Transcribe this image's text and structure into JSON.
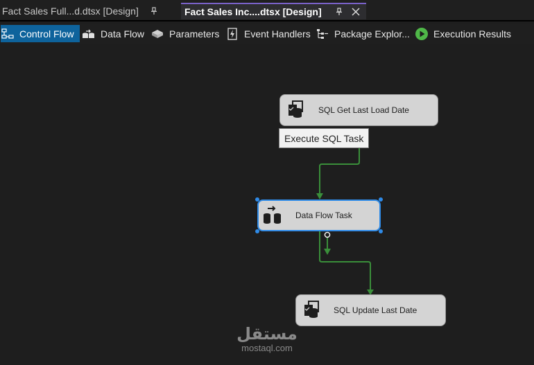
{
  "tabs": [
    {
      "title": "Fact Sales Full...d.dtsx [Design]",
      "active": false
    },
    {
      "title": "Fact Sales Inc....dtsx [Design]",
      "active": true
    }
  ],
  "toolbar": {
    "items": [
      {
        "label": "Control Flow",
        "icon": "control-flow-icon",
        "selected": true
      },
      {
        "label": "Data Flow",
        "icon": "data-flow-icon"
      },
      {
        "label": "Parameters",
        "icon": "parameters-icon"
      },
      {
        "label": "Event Handlers",
        "icon": "event-handlers-icon"
      },
      {
        "label": "Package Explor...",
        "icon": "package-explorer-icon"
      },
      {
        "label": "Execution Results",
        "icon": "execution-results-icon"
      }
    ]
  },
  "canvas": {
    "tasks": [
      {
        "label": "SQL Get Last Load Date",
        "type": "Execute SQL Task",
        "icon": "execute-sql-task-icon"
      },
      {
        "label": "Data Flow Task",
        "type": "Data Flow Task",
        "icon": "data-flow-task-icon",
        "selected": true
      },
      {
        "label": "SQL Update Last Date",
        "type": "Execute SQL Task",
        "icon": "execute-sql-task-icon"
      }
    ],
    "tooltip": "Execute SQL Task",
    "precedence_color": "#3a8f3a",
    "selection_color": "#2f8be8"
  },
  "watermark": {
    "logo": "مستقل",
    "text": "mostaql.com"
  }
}
